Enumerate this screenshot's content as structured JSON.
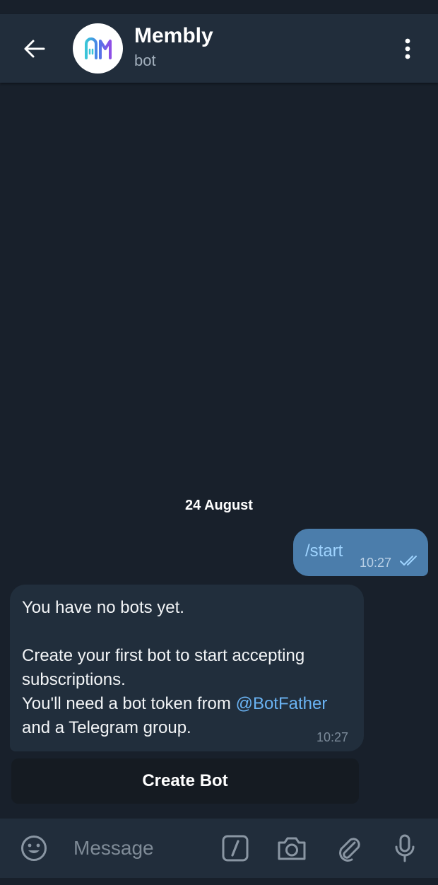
{
  "header": {
    "title": "Membly",
    "subtitle": "bot",
    "back_icon": "arrow-left-icon",
    "more_icon": "more-vertical-icon",
    "avatar_icon": "membly-logo"
  },
  "messages": {
    "date_separator": "24 August",
    "outgoing": {
      "text": "/start",
      "time": "10:27",
      "status_icon": "double-check-icon"
    },
    "incoming": {
      "lines": [
        "You have no bots yet.",
        "",
        "Create your first bot to start accepting",
        "subscriptions.",
        "You'll need a bot token from "
      ],
      "mention": "@BotFather",
      "last_line": "and a Telegram group.",
      "time": "10:27"
    },
    "inline_button": "Create Bot"
  },
  "composer": {
    "placeholder": "Message",
    "icons": [
      "emoji-icon",
      "bot-command-icon",
      "camera-icon",
      "attach-icon",
      "microphone-icon"
    ]
  },
  "colors": {
    "background": "#18202b",
    "header": "#212d3b",
    "outgoing_bubble": "#4b7dab",
    "incoming_bubble": "#212e3c",
    "link": "#6ab3f3"
  }
}
